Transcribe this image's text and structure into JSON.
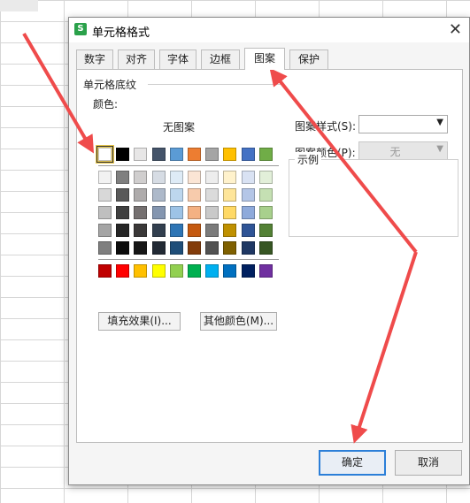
{
  "dialog": {
    "title": "单元格格式",
    "app_icon_glyph": "S",
    "tabs": [
      {
        "label": "数字",
        "active": false
      },
      {
        "label": "对齐",
        "active": false
      },
      {
        "label": "字体",
        "active": false
      },
      {
        "label": "边框",
        "active": false
      },
      {
        "label": "图案",
        "active": true
      },
      {
        "label": "保护",
        "active": false
      }
    ],
    "group_label": "单元格底纹",
    "color_label": "颜色:",
    "no_pattern_label": "无图案",
    "pattern_style_label": "图案样式(S):",
    "pattern_style_value": "",
    "pattern_color_label": "图案颜色(P):",
    "pattern_color_value": "无",
    "sample_label": "示例",
    "fill_effects_button": "填充效果(I)...",
    "more_colors_button": "其他颜色(M)...",
    "ok_button": "确定",
    "cancel_button": "取消",
    "close_glyph": "✕",
    "chevron_glyph": "▼"
  },
  "palette": {
    "selected_color": "#ffffff",
    "theme_top": [
      "#ffffff",
      "#000000",
      "#e7e6e6",
      "#44546a",
      "#5b9bd5",
      "#ed7d31",
      "#a5a5a5",
      "#ffc000",
      "#4472c4",
      "#70ad47"
    ],
    "theme_tints": [
      [
        "#f2f2f2",
        "#7f7f7f",
        "#d0cece",
        "#d6dce4",
        "#deebf6",
        "#fbe5d5",
        "#ededed",
        "#fff2cc",
        "#d9e2f3",
        "#e2efd9"
      ],
      [
        "#d8d8d8",
        "#595959",
        "#aeabab",
        "#adb9ca",
        "#bdd7ee",
        "#f7cbac",
        "#dbdbdb",
        "#fee599",
        "#b4c6e7",
        "#c5e0b3"
      ],
      [
        "#bfbfbf",
        "#3f3f3f",
        "#757070",
        "#8496b0",
        "#9dc3e6",
        "#f4b183",
        "#c9c9c9",
        "#ffd965",
        "#8eaadb",
        "#a8d08d"
      ],
      [
        "#a5a5a5",
        "#262626",
        "#3a3838",
        "#323f4f",
        "#2e75b5",
        "#c55a11",
        "#7b7b7b",
        "#bf9000",
        "#2f5496",
        "#538135"
      ],
      [
        "#7f7f7f",
        "#0c0c0c",
        "#161616",
        "#222a35",
        "#1f4e79",
        "#833c0b",
        "#525252",
        "#7f6000",
        "#1f3864",
        "#375623"
      ]
    ],
    "standard": [
      "#c00000",
      "#ff0000",
      "#ffc000",
      "#ffff00",
      "#92d050",
      "#00b050",
      "#00b0f0",
      "#0070c0",
      "#002060",
      "#7030a0"
    ]
  },
  "annotation_color": "#ef4b4b"
}
